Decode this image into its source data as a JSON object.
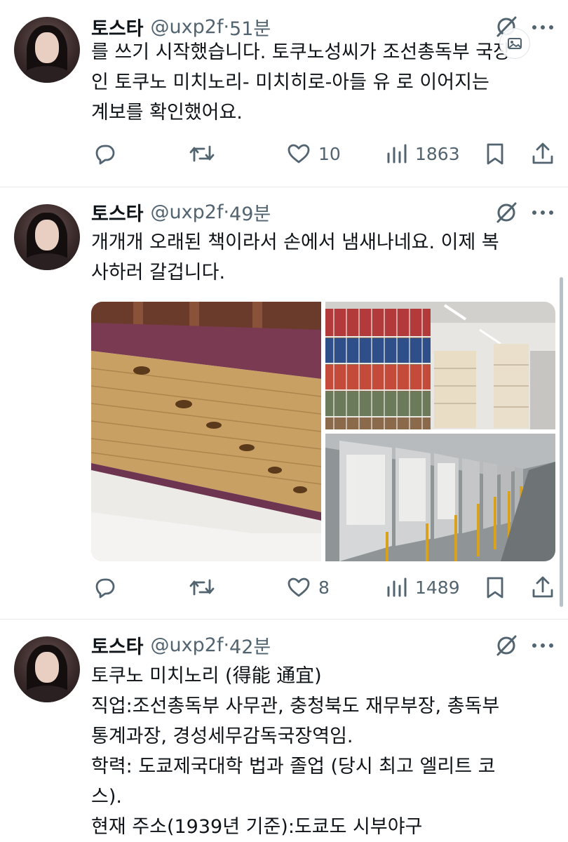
{
  "tweets": [
    {
      "name": "토스타",
      "handle": "@uxp2f",
      "separator": "·",
      "time": "51분",
      "lines": [
        "를 쓰기 시작했습니다. 토쿠노성씨가 조선총독부 국장",
        "인 토쿠노 미치노리- 미치히로-아들 유 로 이어지는",
        "계보를 확인했어요."
      ],
      "likes": "10",
      "views": "1863"
    },
    {
      "name": "토스타",
      "handle": "@uxp2f",
      "separator": "·",
      "time": "49분",
      "lines": [
        "개개개 오래된 책이라서 손에서 냄새나네요. 이제 복",
        "사하러 갈겁니다."
      ],
      "likes": "8",
      "views": "1489"
    },
    {
      "name": "토스타",
      "handle": "@uxp2f",
      "separator": "·",
      "time": "42분",
      "lines": [
        "토쿠노 미치노리 (得能 通宜)",
        "직업:조선총독부 사무관, 충청북도 재무부장, 총독부",
        "통계과장, 경성세무감독국장역임.",
        "학력: 도쿄제국대학 법과 졸업 (당시 최고 엘리트 코",
        "스).",
        "현재 주소(1939년 기준):도쿄도 시부야구"
      ]
    }
  ],
  "icons": {
    "reply": "reply-icon",
    "retweet": "retweet-icon",
    "like": "heart-icon",
    "views": "views-icon",
    "bookmark": "bookmark-icon",
    "share": "share-icon",
    "grok": "grok-icon",
    "more": "more-icon"
  },
  "colors": {
    "text": "#0f1419",
    "secondary": "#536471",
    "divider": "#e6e9ec"
  }
}
